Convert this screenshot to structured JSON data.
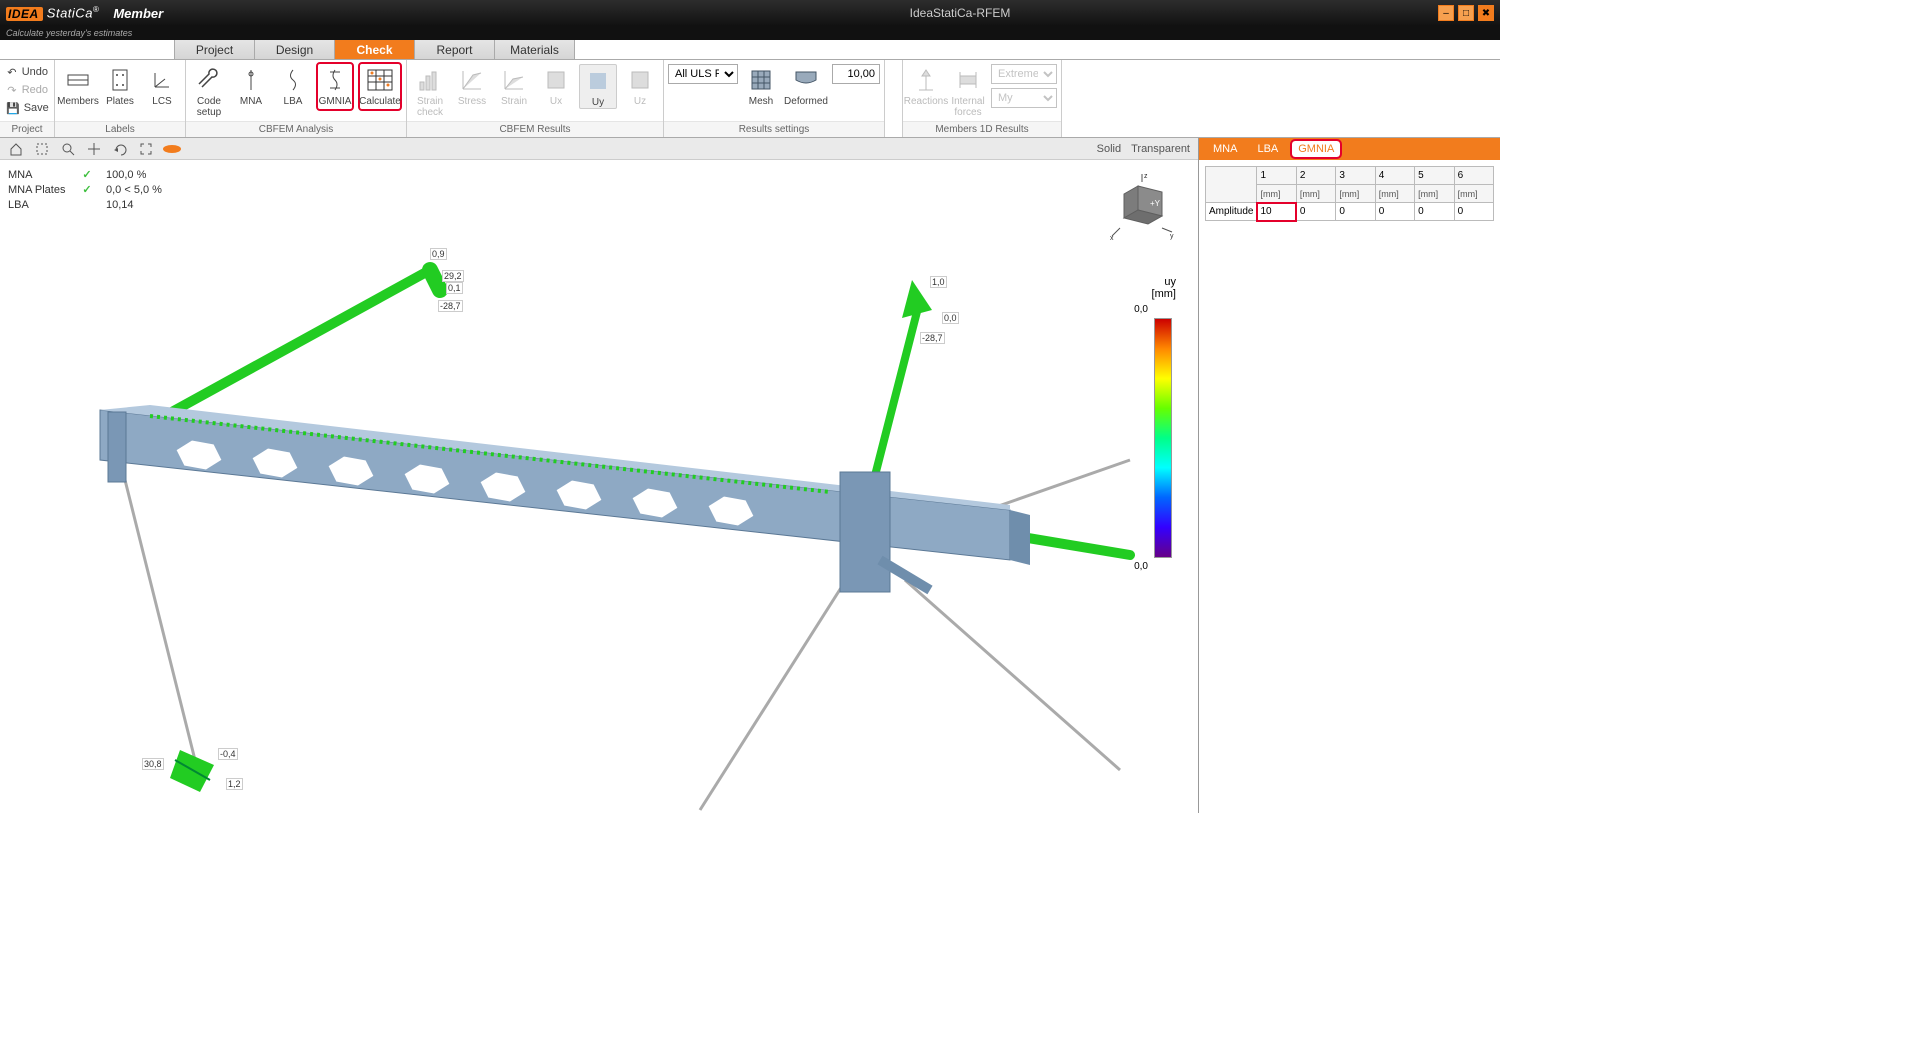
{
  "title": {
    "center": "IdeaStatiCa-RFEM",
    "member_word": "Member",
    "brand_idea": "IDEA",
    "brand_stat": "StatiCa",
    "tagline": "Calculate yesterday's estimates"
  },
  "main_tabs": {
    "project": "Project",
    "design": "Design",
    "check": "Check",
    "report": "Report",
    "materials": "Materials"
  },
  "proj": {
    "undo": "Undo",
    "redo": "Redo",
    "save": "Save"
  },
  "groups": {
    "project": "Project",
    "labels": "Labels",
    "cbfem_analysis": "CBFEM Analysis",
    "cbfem_results": "CBFEM Results",
    "results_settings": "Results settings",
    "members_1d": "Members 1D Results"
  },
  "labels": {
    "members": "Members",
    "plates": "Plates",
    "lcs": "LCS"
  },
  "analysis": {
    "code_setup": "Code setup",
    "mna": "MNA",
    "lba": "LBA",
    "gmnia": "GMNIA",
    "calculate": "Calculate"
  },
  "results": {
    "strain_check": "Strain check",
    "stress": "Stress",
    "strain": "Strain",
    "ux": "Ux",
    "uy": "Uy",
    "uz": "Uz"
  },
  "settings": {
    "combo": "All ULS Fund",
    "mesh": "Mesh",
    "deformed": "Deformed",
    "value": "10,00"
  },
  "m1d": {
    "reactions": "Reactions",
    "internal_forces": "Internal forces",
    "d1": "Extreme",
    "d2": "My"
  },
  "viewport_top": {
    "solid": "Solid",
    "transparent": "Transparent"
  },
  "overlay": {
    "rows": [
      {
        "label": "MNA",
        "check": true,
        "val": "100,0 %"
      },
      {
        "label": "MNA Plates",
        "check": true,
        "val": "0,0 < 5,0 %"
      },
      {
        "label": "LBA",
        "check": false,
        "val": "10,14"
      }
    ]
  },
  "legend": {
    "title_top": "uy",
    "title_unit": "[mm]",
    "top": "0,0",
    "bot": "0,0"
  },
  "nodes": {
    "n0_9": "0,9",
    "n29_2": "29,2",
    "n0_1": "0,1",
    "nm28_7_a": "-28,7",
    "n1_0": "1,0",
    "n0_0": "0,0",
    "nm28_7_b": "-28,7",
    "n30_8": "30,8",
    "nm0_4": "-0,4",
    "n1_2": "1,2"
  },
  "right": {
    "tabs": {
      "mna": "MNA",
      "lba": "LBA",
      "gmnia": "GMNIA"
    },
    "col_nums": [
      "1",
      "2",
      "3",
      "4",
      "5",
      "6"
    ],
    "unit": "[mm]",
    "row_label": "Amplitude",
    "values": [
      "10",
      "0",
      "0",
      "0",
      "0",
      "0"
    ]
  }
}
